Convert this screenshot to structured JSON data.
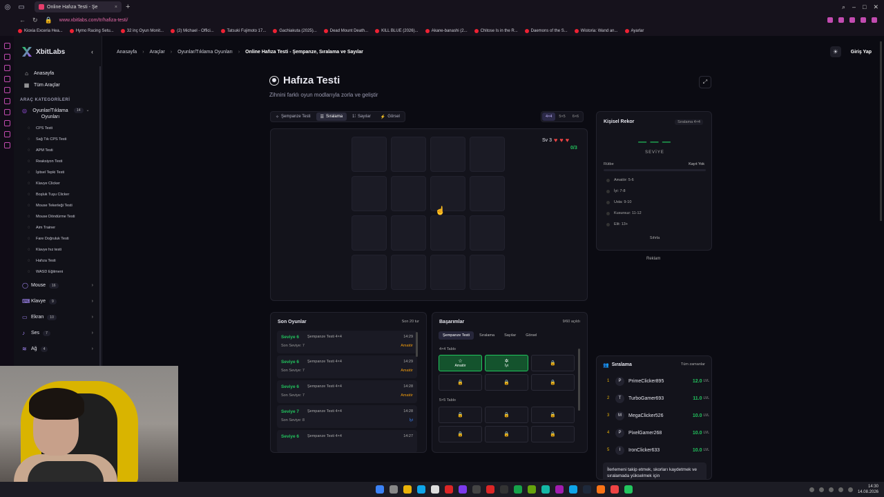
{
  "browser": {
    "tab_title": "Online Hafıza Testi - Şe",
    "url": "www.xbitlabs.com/tr/hafiza-testi/",
    "bookmarks": [
      "Kioxia Exceria Hea...",
      "Hymo Racing Setu...",
      "32 inç Oyun Monit...",
      "(2) Michael - Offici...",
      "Tatsuki Fujimoto 17...",
      "Gachiakuta (2025)...",
      "Dead Mount Death...",
      "KILL BLUE (2026)...",
      "Akane-banashi (2...",
      "Chitose Is in the R...",
      "Daemons of the S...",
      "Wistoria: Wand an...",
      "Ayarlar"
    ]
  },
  "brand": {
    "name": "XbitLabs"
  },
  "sidebar": {
    "home": "Anasayfa",
    "all_tools": "Tüm Araçlar",
    "categories_title": "ARAÇ KATEGORİLERİ",
    "active_category": {
      "label": "Oyunlar/Tıklama Oyunları",
      "count": "14"
    },
    "sub_items": [
      "CPS Testi",
      "Sağ Tık CPS Testi",
      "APM Testi",
      "Reaksiyon Testi",
      "İşitsel Tepki Testi",
      "Klavye Clicker",
      "Boşluk Tuşu Clicker",
      "Mouse Tekerleği Testi",
      "Mouse Döndürme Testi",
      "Aim Trainer",
      "Fare Doğruluk Testi",
      "Klavye hız testi",
      "Hafıza Testi",
      "WASD Eğitmeni"
    ],
    "groups": [
      {
        "label": "Mouse",
        "count": "16"
      },
      {
        "label": "Klavye",
        "count": "9"
      },
      {
        "label": "Ekran",
        "count": "10"
      },
      {
        "label": "Ses",
        "count": "7"
      },
      {
        "label": "Ağ",
        "count": "4"
      }
    ]
  },
  "breadcrumb": [
    "Anasayfa",
    "Araçlar",
    "Oyunlar/Tıklama Oyunları",
    "Online Hafıza Testi - Şempanze, Sıralama ve Sayılar"
  ],
  "header": {
    "login": "Giriş Yap"
  },
  "page": {
    "title": "Hafıza Testi",
    "subtitle": "Zihnini farklı oyun modlarıyla zorla ve geliştir"
  },
  "modes": [
    "Şempanze Testi",
    "Sıralama",
    "Sayılar",
    "Görsel"
  ],
  "sizes": [
    "4×4",
    "5×5",
    "6×6"
  ],
  "game": {
    "level": "Sv 3",
    "progress": "0/3",
    "hearts": 3
  },
  "record": {
    "title": "Kişisel Rekor",
    "badge": "Sıralama 4×4",
    "value": "— — —",
    "level_label": "SEVİYE",
    "rank_label": "Rütbe",
    "no_record": "Kayıt Yok",
    "tiers": [
      "Amatör: 5-6",
      "İyi: 7-8",
      "Usta: 9-10",
      "Kusursuz: 11-12",
      "Elit: 13+"
    ],
    "reset": "Sıfırla"
  },
  "ad": "Reklam",
  "recent": {
    "title": "Son Oyunlar",
    "count": "Son 20 tur",
    "rows": [
      {
        "level": "Seviye 6",
        "mode": "Şempanze Testi 4×4",
        "time": "14:29",
        "last": "Son Seviye: 7",
        "tier": "Amatör"
      },
      {
        "level": "Seviye 6",
        "mode": "Şempanze Testi 4×4",
        "time": "14:29",
        "last": "Son Seviye: 7",
        "tier": "Amatör"
      },
      {
        "level": "Seviye 6",
        "mode": "Şempanze Testi 4×4",
        "time": "14:28",
        "last": "Son Seviye: 7",
        "tier": "Amatör"
      },
      {
        "level": "Seviye 7",
        "mode": "Şempanze Testi 4×4",
        "time": "14:28",
        "last": "Son Seviye: 8",
        "tier": "İyi"
      },
      {
        "level": "Seviye 6",
        "mode": "Şempanze Testi 4×4",
        "time": "14:27",
        "last": "",
        "tier": ""
      }
    ]
  },
  "achievements": {
    "title": "Başarımlar",
    "count": "9/60 açıldı",
    "tabs": [
      "Şempanze Testi",
      "Sıralama",
      "Sayılar",
      "Görsel"
    ],
    "section1": "4×4 Tablo",
    "section2": "5×5 Tablo",
    "cells1": [
      {
        "label": "Amatör",
        "unlocked": true
      },
      {
        "label": "İyi",
        "unlocked": true
      },
      {
        "label": "",
        "unlocked": false
      },
      {
        "label": "",
        "unlocked": false
      },
      {
        "label": "",
        "unlocked": false
      },
      {
        "label": "",
        "unlocked": false
      }
    ],
    "cells2": [
      {
        "label": "",
        "unlocked": false
      },
      {
        "label": "",
        "unlocked": false
      },
      {
        "label": "",
        "unlocked": false
      },
      {
        "label": "",
        "unlocked": false
      },
      {
        "label": "",
        "unlocked": false
      },
      {
        "label": "",
        "unlocked": false
      }
    ]
  },
  "leaderboard": {
    "title": "Sıralama",
    "range": "Tüm zamanlar",
    "unit": "LVL",
    "rows": [
      {
        "rank": "1",
        "avatar": "P",
        "name": "PrimeClicker895",
        "score": "12.0"
      },
      {
        "rank": "2",
        "avatar": "T",
        "name": "TurboGamer693",
        "score": "11.0"
      },
      {
        "rank": "3",
        "avatar": "M",
        "name": "MegaClicker526",
        "score": "10.0"
      },
      {
        "rank": "4",
        "avatar": "P",
        "name": "PixelGamer268",
        "score": "10.0"
      },
      {
        "rank": "5",
        "avatar": "I",
        "name": "IronClicker633",
        "score": "10.0"
      }
    ],
    "note": "İlerlemeni takip etmek, skorları kaydetmek ve sıralamada yükselmek için"
  },
  "taskbar": {
    "time": "14:30",
    "date": "14.08.2026"
  }
}
